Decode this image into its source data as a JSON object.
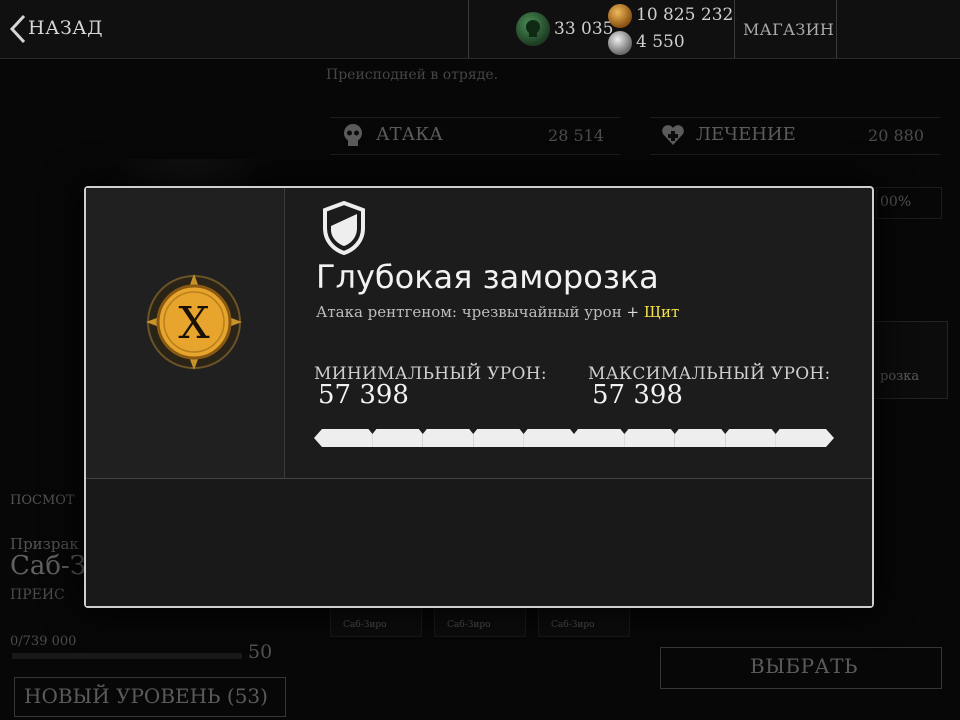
{
  "topbar": {
    "back_label": "НАЗАД",
    "skull_currency": "33 035",
    "gold_currency": "10 825 232",
    "soul_currency": "4 550",
    "shop_label": "МАГАЗИН"
  },
  "background": {
    "description": "Преисподней в отряде.",
    "attack_label": "АТАКА",
    "attack_value": "28 514",
    "heal_label": "ЛЕЧЕНИЕ",
    "heal_value": "20 880",
    "percent_value": "00%",
    "frost_label": "розка",
    "view_label": "ПОСМОТ",
    "ghost_label": "Призрак",
    "character_name": "Саб-З",
    "class_label": "ПРЕИС",
    "xp_text": "0/739 000",
    "level": "50",
    "new_level_label": "НОВЫЙ УРОВЕНЬ (53)",
    "select_label": "ВЫБРАТЬ",
    "card_tags": [
      "Саб-Зиро",
      "Саб-Зиро",
      "Саб-Зиро"
    ]
  },
  "modal": {
    "badge_letter": "X",
    "title": "Глубокая заморозка",
    "description": "Атака рентгеном: чрезвычайный урон",
    "description_plus": "+",
    "description_shield": "Щит",
    "min_damage_label": "МИНИМАЛЬНЫЙ УРОН:",
    "min_damage_value": "57 398",
    "max_damage_label": "МАКСИМАЛЬНЫЙ УРОН:",
    "max_damage_value": "57 398",
    "damage_bar_segments": 10,
    "damage_bar_fill": 1.0
  },
  "colors": {
    "accent_yellow": "#f4e24a",
    "gold_badge": "#e7a52d",
    "skull_green": "#3f7e4b",
    "modal_border": "#cfcfcf"
  },
  "icons": [
    "back-chevron-icon",
    "skull-coin-icon",
    "gold-coin-icon",
    "soul-coin-icon",
    "skull-icon",
    "heart-icon",
    "shield-icon",
    "xray-badge-icon"
  ]
}
